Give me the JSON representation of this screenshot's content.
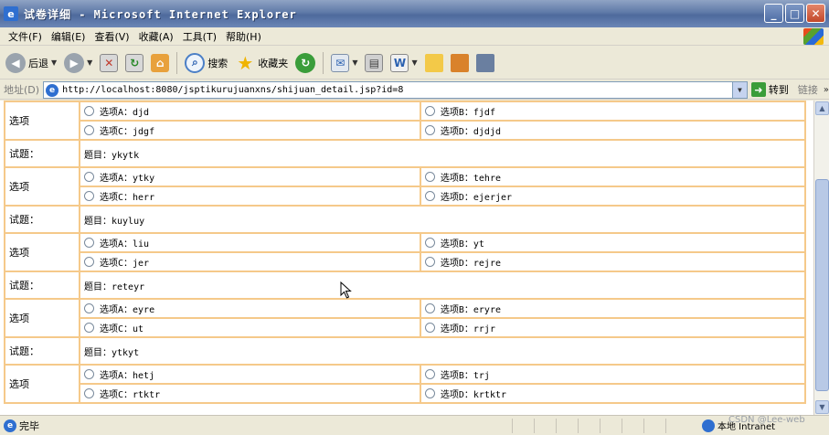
{
  "window": {
    "title": "试卷详细 - Microsoft Internet Explorer",
    "app_icon_glyph": "e",
    "controls": {
      "minimize": "_",
      "maximize": "□",
      "close": "✕"
    }
  },
  "menu": [
    "文件(F)",
    "编辑(E)",
    "查看(V)",
    "收藏(A)",
    "工具(T)",
    "帮助(H)"
  ],
  "toolbar": {
    "back_label": "后退",
    "search_label": "搜索",
    "favorites_label": "收藏夹",
    "icons": {
      "back": "arrow-left",
      "forward": "arrow-right",
      "stop": "x",
      "refresh": "refresh",
      "home": "house"
    }
  },
  "address": {
    "label": "地址(D)",
    "url": "http://localhost:8080/jsptikurujuanxns/shijuan_detail.jsp?id=8",
    "go_label": "转到",
    "links_label": "链接",
    "more": "»"
  },
  "exam": {
    "option_label": "选项",
    "question_label": "试题：",
    "questions": [
      {
        "title": "",
        "options": [
          "选项A：djd",
          "选项B：fjdf",
          "选项C：jdgf",
          "选项D：djdjd"
        ]
      },
      {
        "title": "题目：ykytk",
        "options": [
          "选项A：ytky",
          "选项B：tehre",
          "选项C：herr",
          "选项D：ejerjer"
        ]
      },
      {
        "title": "题目：kuyluy",
        "options": [
          "选项A：liu",
          "选项B：yt",
          "选项C：jer",
          "选项D：rejre"
        ]
      },
      {
        "title": "题目：reteyr",
        "options": [
          "选项A：eyre",
          "选项B：eryre",
          "选项C：ut",
          "选项D：rrjr"
        ]
      },
      {
        "title": "题目：ytkyt",
        "options": [
          "选项A：hetj",
          "选项B：trj",
          "选项C：rtktr",
          "选项D：krtktr"
        ]
      }
    ]
  },
  "status": {
    "text": "完毕",
    "zone": "本地 Intranet"
  },
  "watermark": "CSDN @Lee-web",
  "colors": {
    "table_border": "#f5c98a",
    "title_bar": "#5f7aa8"
  }
}
